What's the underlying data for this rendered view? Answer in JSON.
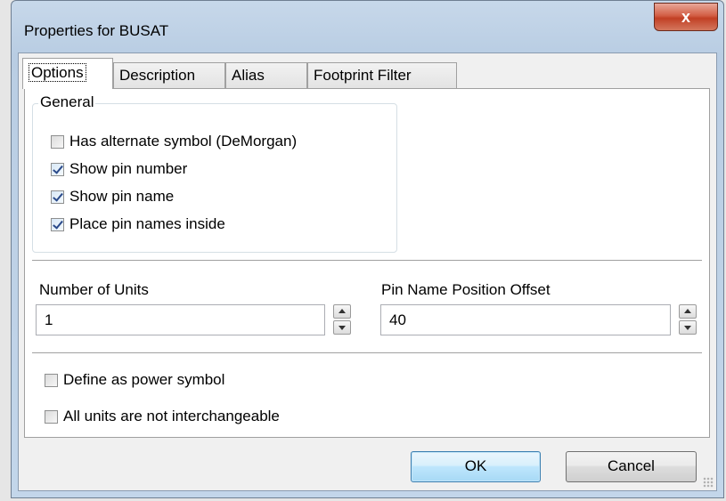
{
  "window": {
    "title": "Properties for BUSAT",
    "close_glyph": "x"
  },
  "tabs": [
    {
      "label": "Options",
      "active": true
    },
    {
      "label": "Description",
      "active": false
    },
    {
      "label": "Alias",
      "active": false
    },
    {
      "label": "Footprint Filter",
      "active": false
    }
  ],
  "general": {
    "legend": "General",
    "options": [
      {
        "label": "Has alternate symbol (DeMorgan)",
        "checked": false
      },
      {
        "label": "Show pin number",
        "checked": true
      },
      {
        "label": "Show pin name",
        "checked": true
      },
      {
        "label": "Place pin names inside",
        "checked": true
      }
    ]
  },
  "units": {
    "label": "Number of Units",
    "value": "1"
  },
  "offset": {
    "label": "Pin Name Position Offset",
    "value": "40"
  },
  "power": {
    "options": [
      {
        "label": "Define as power symbol",
        "checked": false
      },
      {
        "label": "All units are not interchangeable",
        "checked": false
      }
    ]
  },
  "buttons": {
    "ok_label": "OK",
    "cancel_label": "Cancel"
  },
  "colors": {
    "title_bar": "#b9cde3",
    "close_button": "#c94a2f",
    "ok_button_border": "#3c7fb1",
    "checkmark": "#2a4a8a"
  },
  "icons": {
    "close": "close-icon",
    "spin_up": "arrow-up-icon",
    "spin_down": "arrow-down-icon",
    "checkmark": "checkmark-icon",
    "resize": "resize-grip-icon"
  }
}
